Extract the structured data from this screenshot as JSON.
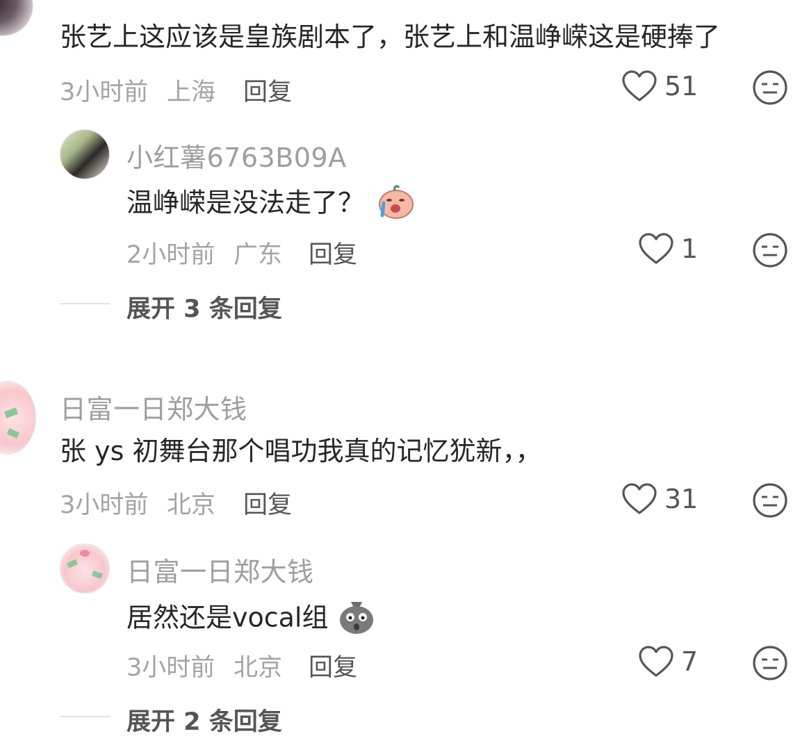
{
  "comments": [
    {
      "username": "",
      "content": "张艺上这应该是皇族剧本了，张艺上和温峥嵘这是硬捧了",
      "time": "3小时前",
      "location": "上海",
      "reply_label": "回复",
      "likes": "51",
      "replies": [
        {
          "username": "小红薯6763B09A",
          "content": "温峥嵘是没法走了？",
          "emoji": "crying-face-emoji",
          "time": "2小时前",
          "location": "广东",
          "reply_label": "回复",
          "likes": "1"
        }
      ],
      "expand_label": "展开 3 条回复"
    },
    {
      "username": "日富一日郑大钱",
      "content": "张 ys 初舞台那个唱功我真的记忆犹新，，",
      "time": "3小时前",
      "location": "北京",
      "reply_label": "回复",
      "likes": "31",
      "replies": [
        {
          "username": "日富一日郑大钱",
          "content": "居然还是vocal组",
          "emoji": "shocked-bag-emoji",
          "time": "3小时前",
          "location": "北京",
          "reply_label": "回复",
          "likes": "7"
        }
      ],
      "expand_label": "展开 2 条回复"
    }
  ],
  "icons": {
    "like": "heart-outline-icon",
    "dislike": "meh-face-icon"
  },
  "colors": {
    "username": "#9e9e9e",
    "content": "#262626",
    "meta": "#a3a3a3",
    "icon": "#555555"
  }
}
